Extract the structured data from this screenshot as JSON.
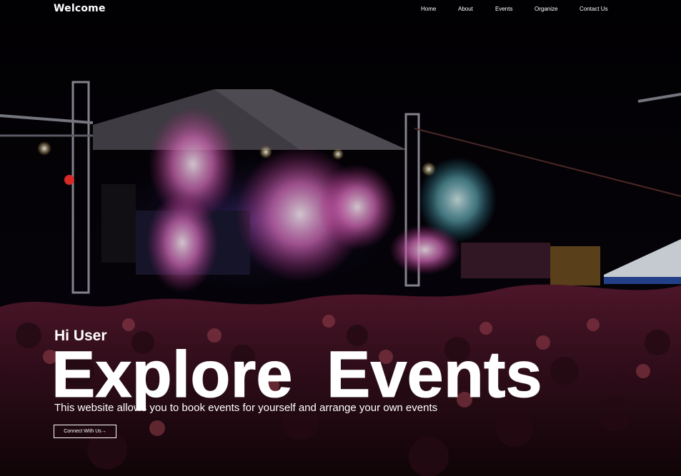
{
  "header": {
    "brand": "Welcome",
    "nav": [
      {
        "label": "Home"
      },
      {
        "label": "About"
      },
      {
        "label": "Events"
      },
      {
        "label": "Organize"
      },
      {
        "label": "Contact Us"
      }
    ]
  },
  "hero": {
    "greeting": "Hi User",
    "headline_part1": "Explore",
    "headline_part2": "Events",
    "description": "This website allows you to book events for yourself and arrange your own events",
    "cta_label": "Connect With Us→"
  },
  "colors": {
    "text": "#ffffff",
    "background": "#050307"
  }
}
